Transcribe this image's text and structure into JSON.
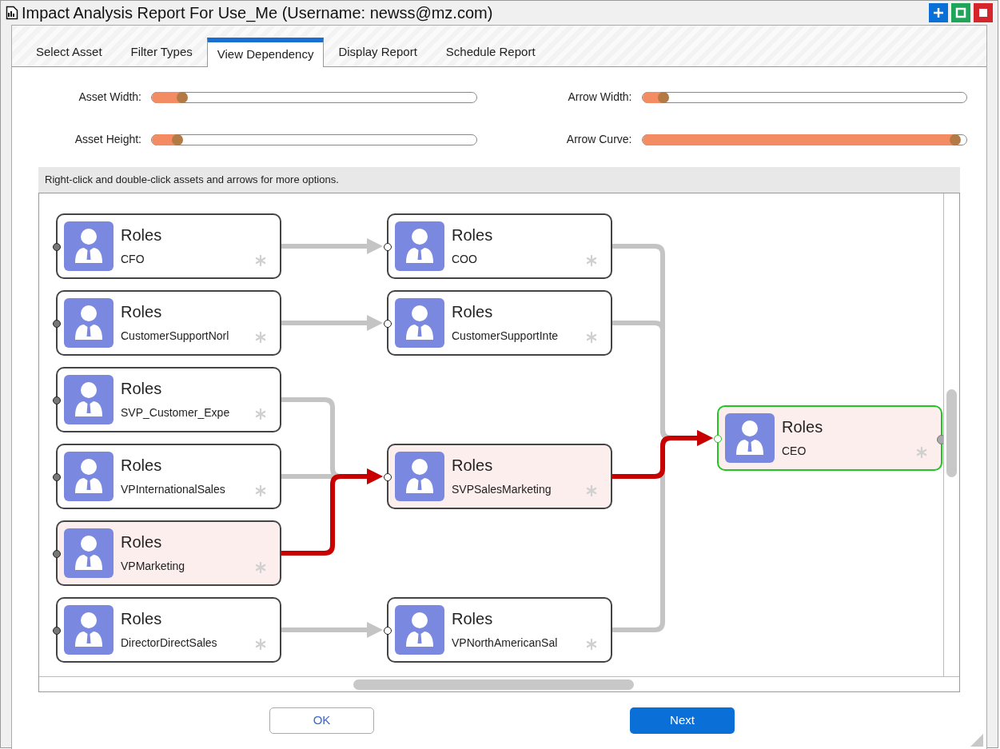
{
  "window": {
    "title": "Impact Analysis Report For Use_Me (Username: newss@mz.com)"
  },
  "tabs": [
    {
      "label": "Select Asset",
      "selected": false
    },
    {
      "label": "Filter Types",
      "selected": false
    },
    {
      "label": "View Dependency",
      "selected": true
    },
    {
      "label": "Display Report",
      "selected": false
    },
    {
      "label": "Schedule Report",
      "selected": false
    }
  ],
  "sliders": [
    {
      "label": "Asset Width:",
      "level": 0.08
    },
    {
      "label": "Arrow Width:",
      "level": 0.05
    },
    {
      "label": "Asset Height:",
      "level": 0.065
    },
    {
      "label": "Arrow Curve:",
      "level": 0.95
    }
  ],
  "hint": "Right-click and double-click assets and arrows for more options.",
  "diagram": {
    "nodes": [
      {
        "type": "Roles",
        "name": "CFO",
        "highlighted": false,
        "selected": false
      },
      {
        "type": "Roles",
        "name": "CustomerSupportNorl",
        "highlighted": false,
        "selected": false
      },
      {
        "type": "Roles",
        "name": "SVP_Customer_Expe",
        "highlighted": false,
        "selected": false
      },
      {
        "type": "Roles",
        "name": "VPInternationalSales",
        "highlighted": false,
        "selected": false
      },
      {
        "type": "Roles",
        "name": "VPMarketing",
        "highlighted": true,
        "selected": false
      },
      {
        "type": "Roles",
        "name": "DirectorDirectSales",
        "highlighted": false,
        "selected": false
      },
      {
        "type": "Roles",
        "name": "COO",
        "highlighted": false,
        "selected": false
      },
      {
        "type": "Roles",
        "name": "CustomerSupportInte",
        "highlighted": false,
        "selected": false
      },
      {
        "type": "Roles",
        "name": "SVPSalesMarketing",
        "highlighted": true,
        "selected": false
      },
      {
        "type": "Roles",
        "name": "VPNorthAmericanSal",
        "highlighted": false,
        "selected": false
      },
      {
        "type": "Roles",
        "name": "CEO",
        "highlighted": true,
        "selected": true
      }
    ]
  },
  "buttons": [
    {
      "label": "OK",
      "kind": "secondary"
    },
    {
      "label": "Next",
      "kind": "primary"
    }
  ]
}
